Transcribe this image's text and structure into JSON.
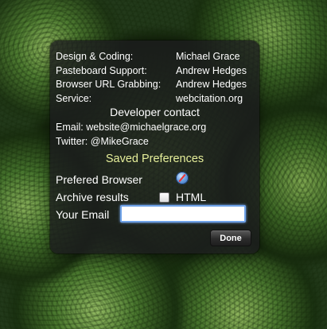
{
  "credits": [
    {
      "role": "Design & Coding:",
      "name": "Michael Grace"
    },
    {
      "role": "Pasteboard Support:",
      "name": "Andrew Hedges"
    },
    {
      "role": "Browser URL Grabbing:",
      "name": "Andrew Hedges"
    },
    {
      "role": "Service:",
      "name": "webcitation.org"
    }
  ],
  "developer": {
    "heading": "Developer contact",
    "email": "Email: website@michaelgrace.org",
    "twitter": "Twitter: @MikeGrace"
  },
  "preferences": {
    "heading": "Saved Preferences",
    "browser_label": "Prefered Browser",
    "browser_icon": "safari-compass-icon",
    "archive_label": "Archive results",
    "archive_checked": false,
    "archive_option": "HTML",
    "email_label": "Your Email",
    "email_value": ""
  },
  "buttons": {
    "done": "Done"
  },
  "colors": {
    "panel_bg": "#1c1c1e",
    "heading_accent": "#e6ef9a",
    "input_focus": "#6fa2e8"
  }
}
